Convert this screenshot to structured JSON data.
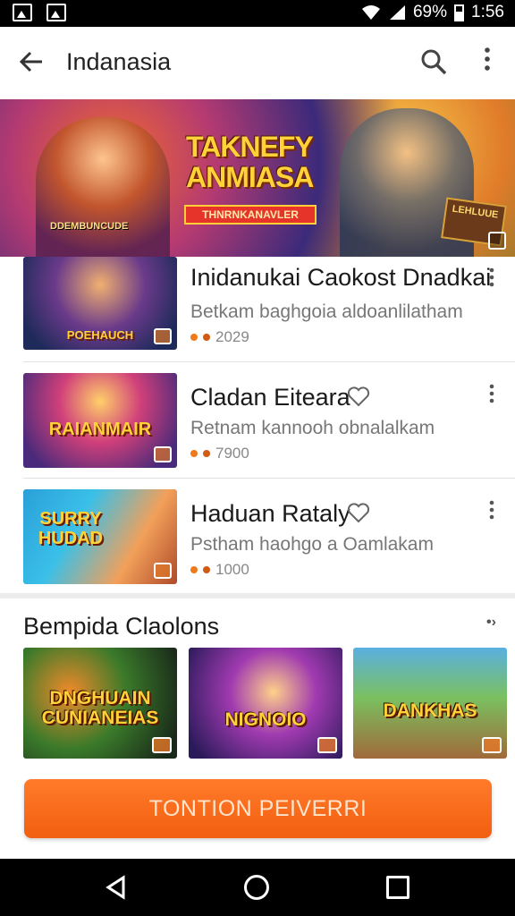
{
  "status_bar": {
    "battery": "69%",
    "time": "1:56"
  },
  "app_bar": {
    "title": "Indanasia"
  },
  "banner": {
    "title": "TAKNEFY ANMIASA",
    "ribbon": "THNRNKANAVLER",
    "left_label": "DDEMBUNCUDE",
    "badge": "LEHLUUE"
  },
  "list": [
    {
      "title": "Inidanukai Caokost Dnadkai",
      "subtitle": "Betkam baghgoia aldoanlilatham",
      "meta": "2029",
      "thumb_label": "POEHAUCH"
    },
    {
      "title": "Cladan Eiteara",
      "subtitle": "Retnam kannooh obnalalkam",
      "meta": "7900",
      "thumb_label": "RAIANMAIR"
    },
    {
      "title": "Haduan Rataly",
      "subtitle": "Pstham haohgo a Oamlakam",
      "meta": "1000",
      "thumb_label": "SURRY HUDAD"
    }
  ],
  "section": {
    "title": "Bempida Claolons",
    "more": "•›",
    "tiles": [
      {
        "label": "DNGHUAIN CUNIANEIAS"
      },
      {
        "label": "NIGNOIO"
      },
      {
        "label": "DANKHAS"
      }
    ]
  },
  "cta": {
    "label": "TONTION PEIVERRI"
  },
  "colors": {
    "accent": "#f36a18",
    "dot": "#f07a1a"
  }
}
